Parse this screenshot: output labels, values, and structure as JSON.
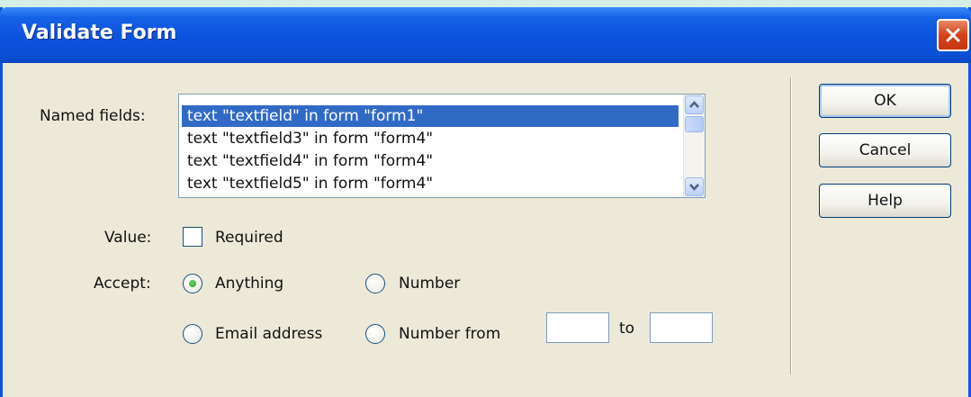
{
  "window": {
    "title": "Validate Form"
  },
  "fields": {
    "named_fields_label": "Named fields:",
    "items": [
      {
        "label": "text \"textfield\" in form \"form1\"",
        "selected": true
      },
      {
        "label": "text \"textfield3\" in form \"form4\"",
        "selected": false
      },
      {
        "label": "text \"textfield4\" in form \"form4\"",
        "selected": false
      },
      {
        "label": "text \"textfield5\" in form \"form4\"",
        "selected": false
      }
    ]
  },
  "value": {
    "label": "Value:",
    "required_label": "Required",
    "required_checked": false
  },
  "accept": {
    "label": "Accept:",
    "options": {
      "anything": "Anything",
      "number": "Number",
      "email": "Email address",
      "number_from": "Number from"
    },
    "selected": "anything",
    "to_label": "to",
    "from_value": "",
    "to_value": ""
  },
  "buttons": {
    "ok": "OK",
    "cancel": "Cancel",
    "help": "Help"
  },
  "colors": {
    "title_bar": "#0b52dd",
    "selection": "#316ac5",
    "radio_dot": "#21a121",
    "close": "#d8411a"
  },
  "icons": {
    "close": "close-x-icon",
    "scroll_up": "chevron-up-icon",
    "scroll_down": "chevron-down-icon"
  }
}
